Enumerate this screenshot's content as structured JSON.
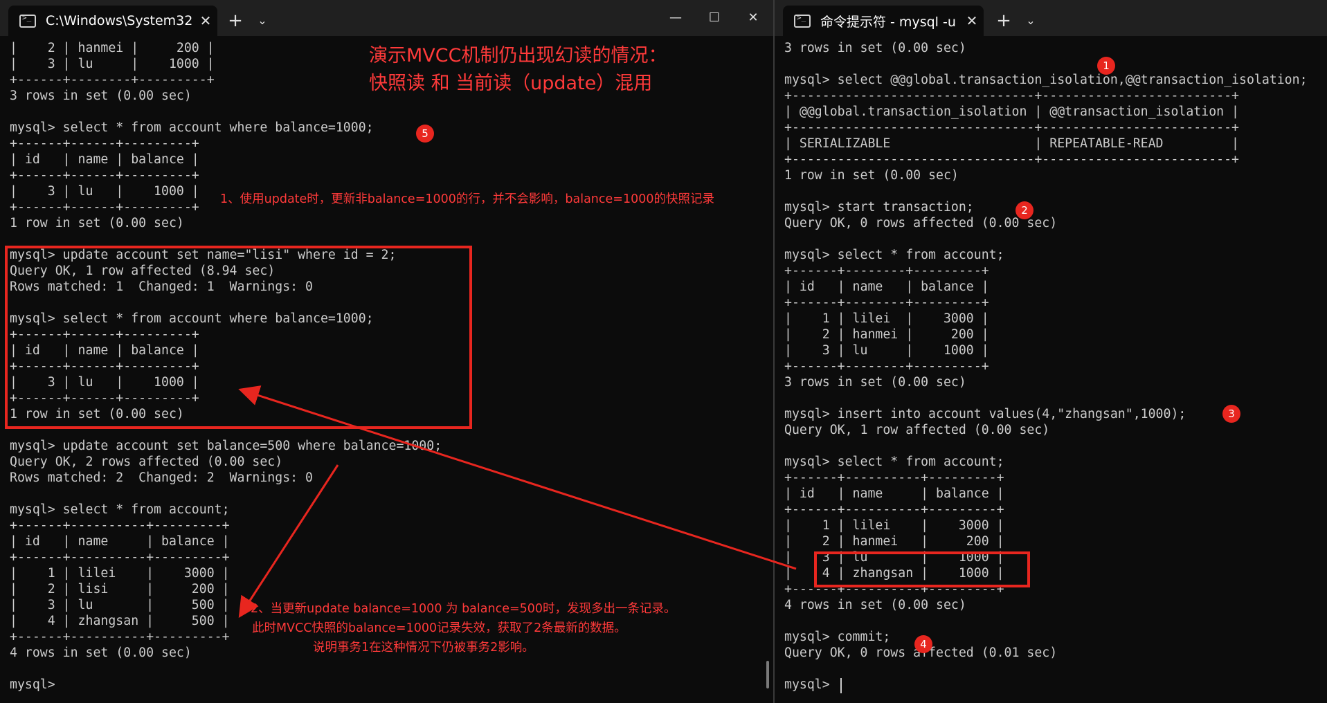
{
  "left_window": {
    "tab_title": "C:\\Windows\\System32",
    "tab_close": "✕",
    "new_tab": "+",
    "dropdown": "⌄",
    "minimize": "—",
    "maximize": "☐",
    "close": "✕",
    "console_lines": [
      "|    2 | hanmei |     200 |",
      "|    3 | lu     |    1000 |",
      "+------+--------+---------+",
      "3 rows in set (0.00 sec)",
      "",
      "mysql> select * from account where balance=1000;",
      "+------+------+---------+",
      "| id   | name | balance |",
      "+------+------+---------+",
      "|    3 | lu   |    1000 |",
      "+------+------+---------+",
      "1 row in set (0.00 sec)",
      "",
      "mysql> update account set name=\"lisi\" where id = 2;",
      "Query OK, 1 row affected (8.94 sec)",
      "Rows matched: 1  Changed: 1  Warnings: 0",
      "",
      "mysql> select * from account where balance=1000;",
      "+------+------+---------+",
      "| id   | name | balance |",
      "+------+------+---------+",
      "|    3 | lu   |    1000 |",
      "+------+------+---------+",
      "1 row in set (0.00 sec)",
      "",
      "mysql> update account set balance=500 where balance=1000;",
      "Query OK, 2 rows affected (0.00 sec)",
      "Rows matched: 2  Changed: 2  Warnings: 0",
      "",
      "mysql> select * from account;",
      "+------+----------+---------+",
      "| id   | name     | balance |",
      "+------+----------+---------+",
      "|    1 | lilei    |    3000 |",
      "|    2 | lisi     |     200 |",
      "|    3 | lu       |     500 |",
      "|    4 | zhangsan |     500 |",
      "+------+----------+---------+",
      "4 rows in set (0.00 sec)",
      "",
      "mysql> "
    ]
  },
  "right_window": {
    "tab_title": "命令提示符 - mysql  -u",
    "tab_close": "✕",
    "new_tab": "+",
    "dropdown": "⌄",
    "console_lines": [
      "3 rows in set (0.00 sec)",
      "",
      "mysql> select @@global.transaction_isolation,@@transaction_isolation;",
      "+--------------------------------+-------------------------+",
      "| @@global.transaction_isolation | @@transaction_isolation |",
      "+--------------------------------+-------------------------+",
      "| SERIALIZABLE                   | REPEATABLE-READ         |",
      "+--------------------------------+-------------------------+",
      "1 row in set (0.00 sec)",
      "",
      "mysql> start transaction;",
      "Query OK, 0 rows affected (0.00 sec)",
      "",
      "mysql> select * from account;",
      "+------+--------+---------+",
      "| id   | name   | balance |",
      "+------+--------+---------+",
      "|    1 | lilei  |    3000 |",
      "|    2 | hanmei |     200 |",
      "|    3 | lu     |    1000 |",
      "+------+--------+---------+",
      "3 rows in set (0.00 sec)",
      "",
      "mysql> insert into account values(4,\"zhangsan\",1000);",
      "Query OK, 1 row affected (0.00 sec)",
      "",
      "mysql> select * from account;",
      "+------+----------+---------+",
      "| id   | name     | balance |",
      "+------+----------+---------+",
      "|    1 | lilei    |    3000 |",
      "|    2 | hanmei   |     200 |",
      "|    3 | lu       |    1000 |",
      "|    4 | zhangsan |    1000 |",
      "+------+----------+---------+",
      "4 rows in set (0.00 sec)",
      "",
      "mysql> commit;",
      "Query OK, 0 rows affected (0.01 sec)",
      "",
      "mysql> "
    ]
  },
  "annotations": {
    "title_line1": "演示MVCC机制仍出现幻读的情况：",
    "title_line2": "快照读 和  当前读（update）混用",
    "note1": "1、使用update时，更新非balance=1000的行，并不会影响，balance=1000的快照记录",
    "note2_line1": "2、当更新update balance=1000 为 balance=500时，发现多出一条记录。",
    "note2_line2": "此时MVCC快照的balance=1000记录失效，获取了2条最新的数据。",
    "note2_line3": "说明事务1在这种情况下仍被事务2影响。",
    "badges": [
      "1",
      "2",
      "3",
      "4",
      "5"
    ]
  },
  "colors": {
    "background": "#0c0c0c",
    "console_text": "#cccccc",
    "annotation": "#ff3a3a",
    "highlight": "#e8261f",
    "titlebar": "#202020"
  },
  "icons": {
    "tab_icon": "terminal-icon",
    "close": "close-icon",
    "new_tab": "plus-icon",
    "dropdown": "chevron-down-icon",
    "minimize": "minimize-icon",
    "maximize": "maximize-icon"
  }
}
